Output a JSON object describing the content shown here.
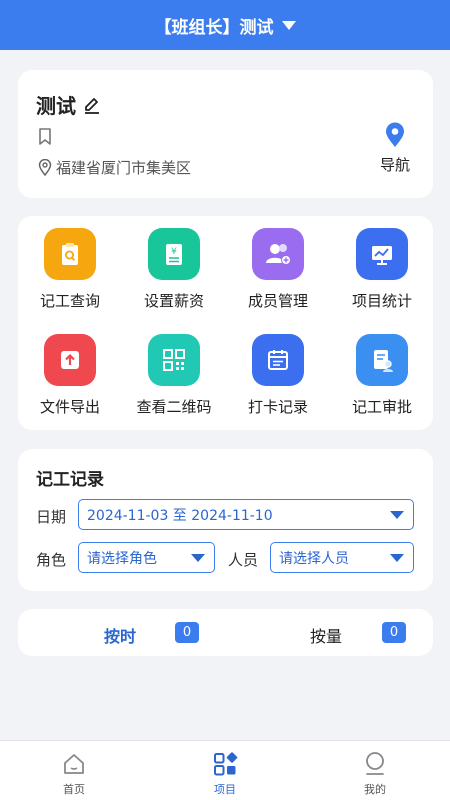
{
  "header": {
    "title": "【班组长】测试"
  },
  "project": {
    "name": "测试",
    "address": "福建省厦门市集美区",
    "nav_label": "导航"
  },
  "grid": [
    {
      "label": "记工查询",
      "icon": "clipboard-search-icon",
      "color": "#f6a60f"
    },
    {
      "label": "设置薪资",
      "icon": "salary-doc-icon",
      "color": "#19c69a"
    },
    {
      "label": "成员管理",
      "icon": "members-icon",
      "color": "#9a6cf0"
    },
    {
      "label": "项目统计",
      "icon": "chart-board-icon",
      "color": "#3b6ff0"
    },
    {
      "label": "文件导出",
      "icon": "upload-icon",
      "color": "#f0484f"
    },
    {
      "label": "查看二维码",
      "icon": "qrcode-icon",
      "color": "#21c9b4"
    },
    {
      "label": "打卡记录",
      "icon": "calendar-icon",
      "color": "#3b6ff0"
    },
    {
      "label": "记工审批",
      "icon": "approval-icon",
      "color": "#3a8ff0"
    }
  ],
  "records": {
    "title": "记工记录",
    "date_label": "日期",
    "date_range": "2024-11-03 至 2024-11-10",
    "role_label": "角色",
    "role_placeholder": "请选择角色",
    "person_label": "人员",
    "person_placeholder": "请选择人员"
  },
  "toggle": {
    "by_time": "按时",
    "by_time_count": "0",
    "by_quantity": "按量",
    "by_quantity_count": "0"
  },
  "tabs": [
    {
      "label": "首页",
      "icon": "home-icon"
    },
    {
      "label": "项目",
      "icon": "grid-apps-icon"
    },
    {
      "label": "我的",
      "icon": "user-icon"
    }
  ],
  "colors": {
    "primary": "#3b7dee",
    "background": "#f2f3f7"
  }
}
